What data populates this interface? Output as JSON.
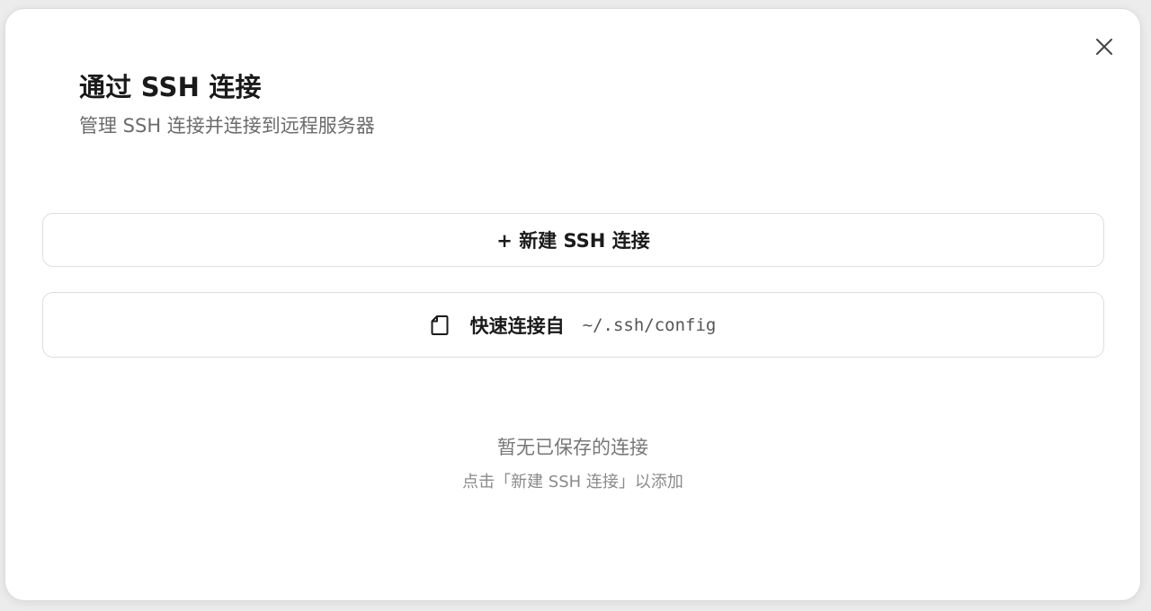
{
  "dialog": {
    "title": "通过 SSH 连接",
    "subtitle": "管理 SSH 连接并连接到远程服务器",
    "close_icon": "close-icon"
  },
  "actions": {
    "new_connection_label": "+ 新建 SSH 连接",
    "quick_connect_label": "快速连接自",
    "quick_connect_path": "~/.ssh/config",
    "quick_connect_icon": "file-icon"
  },
  "empty_state": {
    "title": "暂无已保存的连接",
    "hint": "点击「新建 SSH 连接」以添加"
  }
}
